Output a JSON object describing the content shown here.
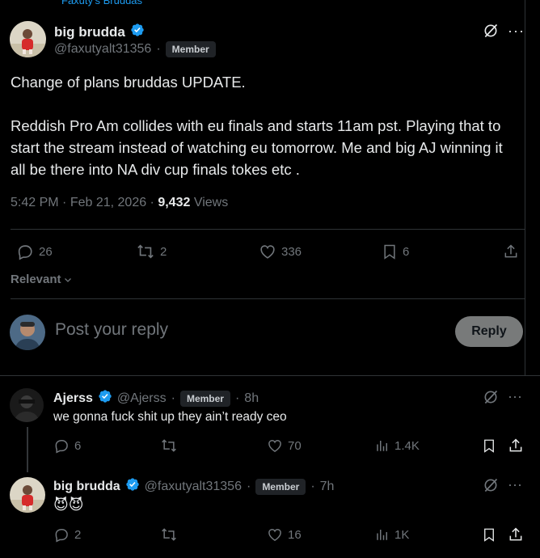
{
  "header_cut": "Faxuty's Bruddas",
  "post": {
    "author_name": "big brudda",
    "author_handle": "@faxutyalt31356",
    "member_badge": "Member",
    "dot": "·",
    "text_line1": "Change of plans bruddas UPDATE.",
    "text_para2": "Reddish Pro Am collides with eu finals and starts 11am pst. Playing that to start the stream instead of watching eu tomorrow. Me and big AJ winning it all be there into NA div cup finals tokes etc .",
    "time": "5:42 PM",
    "date": "Feb 21, 2026",
    "views_count": "9,432",
    "views_label": "Views",
    "replies": "26",
    "reposts": "2",
    "likes": "336",
    "bookmarks": "6"
  },
  "sort": {
    "label": "Relevant"
  },
  "composer": {
    "placeholder": "Post your reply",
    "button": "Reply"
  },
  "replies": [
    {
      "name": "Ajerss",
      "handle": "@Ajerss",
      "badge": "Member",
      "time": "8h",
      "text": "we gonna fuck shit up they ain’t ready ceo",
      "replies": "6",
      "reposts": "",
      "likes": "70",
      "views": "1.4K"
    },
    {
      "name": "big brudda",
      "handle": "@faxutyalt31356",
      "badge": "Member",
      "time": "7h",
      "text": "😈😈",
      "replies": "2",
      "reposts": "",
      "likes": "16",
      "views": "1K"
    }
  ],
  "colors": {
    "accent": "#1d9bf0",
    "muted": "#71767b",
    "text": "#e7e9ea",
    "bg": "#000000"
  }
}
